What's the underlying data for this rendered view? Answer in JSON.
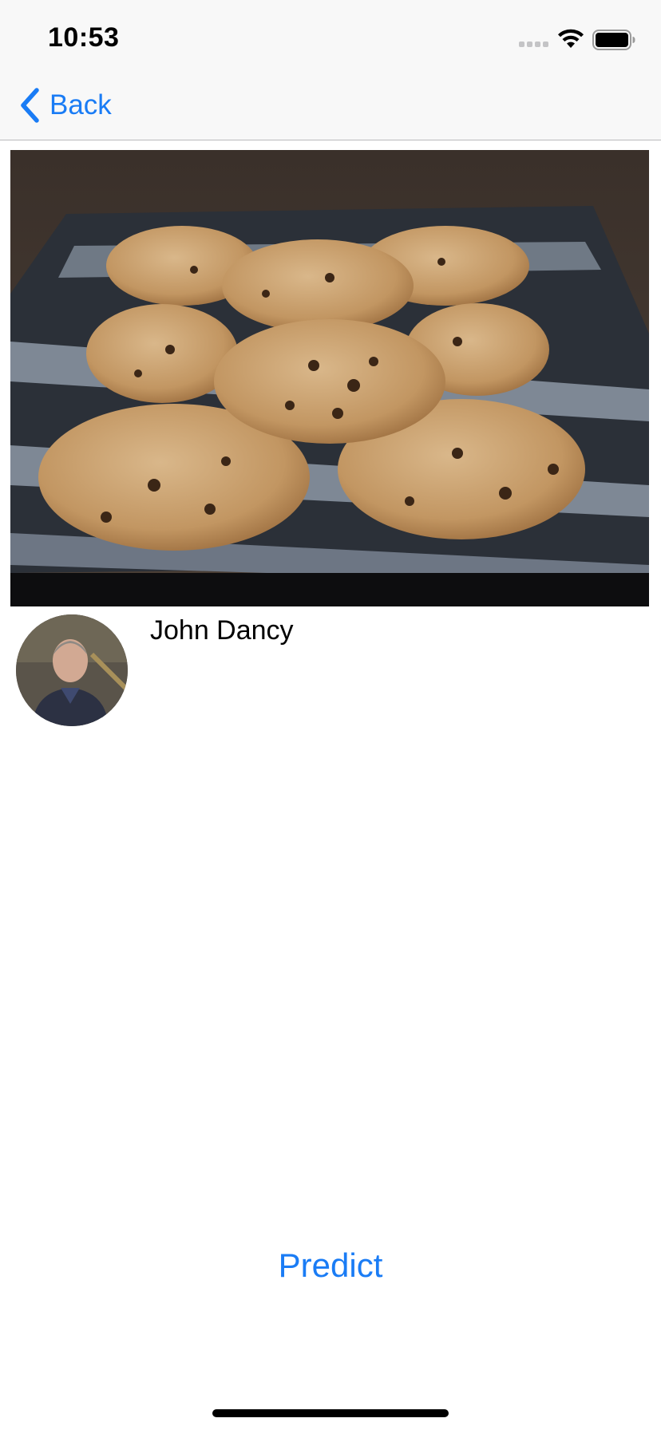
{
  "status_bar": {
    "time": "10:53",
    "icons": [
      "cellular-signal-icon",
      "wifi-icon",
      "battery-icon"
    ]
  },
  "nav": {
    "back_label": "Back",
    "back_icon": "chevron-left-icon"
  },
  "hero_image": {
    "subject": "chocolate-chip-cookies-on-tray"
  },
  "author": {
    "name": "John Dancy",
    "avatar": "profile-photo"
  },
  "actions": {
    "predict_label": "Predict"
  },
  "colors": {
    "accent": "#1a7cf5",
    "nav_background": "#f8f8f8",
    "text": "#000000"
  }
}
